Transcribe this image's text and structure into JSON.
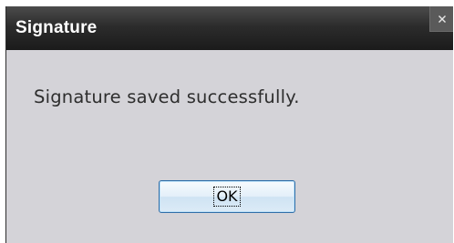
{
  "dialog": {
    "title": "Signature",
    "close_glyph": "×",
    "message": "Signature saved successfully.",
    "ok_label": "OK"
  },
  "icons": {
    "close": "close-icon"
  },
  "colors": {
    "titlebar": "#2c2c2c",
    "body": "#d4d3d8",
    "title_text": "#ffffff",
    "message_text": "#2e2e2e",
    "button_border": "#2f6ea8"
  }
}
